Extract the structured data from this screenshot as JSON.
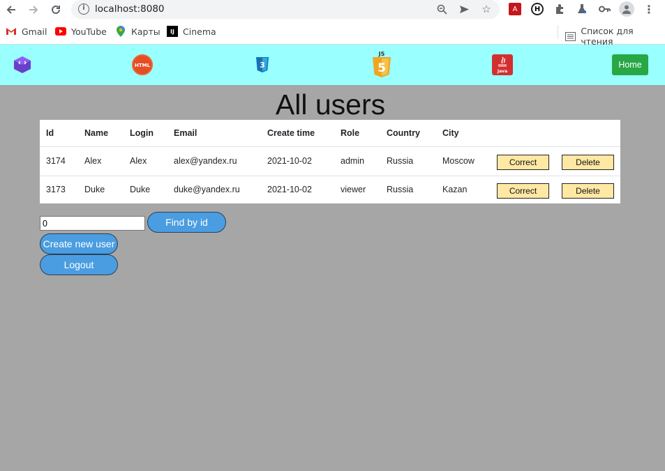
{
  "browser": {
    "url": "localhost:8080",
    "bookmarks": [
      {
        "label": "Gmail",
        "icon": "gmail-icon"
      },
      {
        "label": "YouTube",
        "icon": "youtube-icon"
      },
      {
        "label": "Карты",
        "icon": "maps-icon"
      },
      {
        "label": "Cinema",
        "icon": "intellij-icon"
      }
    ],
    "reading_list": "Список для чтения"
  },
  "header": {
    "logos": [
      "app-cube-logo",
      "html-logo",
      "css3-logo",
      "js-html5-logo",
      "java-logo"
    ],
    "home_label": "Home",
    "home_color": "#28a745",
    "bg_color": "#99ffff"
  },
  "main": {
    "title": "All users",
    "table": {
      "columns": [
        "Id",
        "Name",
        "Login",
        "Email",
        "Create time",
        "Role",
        "Country",
        "City"
      ],
      "rows": [
        [
          "3174",
          "Alex",
          "Alex",
          "alex@yandex.ru",
          "2021-10-02",
          "admin",
          "Russia",
          "Moscow"
        ],
        [
          "3173",
          "Duke",
          "Duke",
          "duke@yandex.ru",
          "2021-10-02",
          "viewer",
          "Russia",
          "Kazan"
        ]
      ],
      "correct_label": "Correct",
      "delete_label": "Delete"
    },
    "find": {
      "value": "0",
      "button": "Find by id"
    },
    "create_label": "Create new user",
    "logout_label": "Logout"
  }
}
